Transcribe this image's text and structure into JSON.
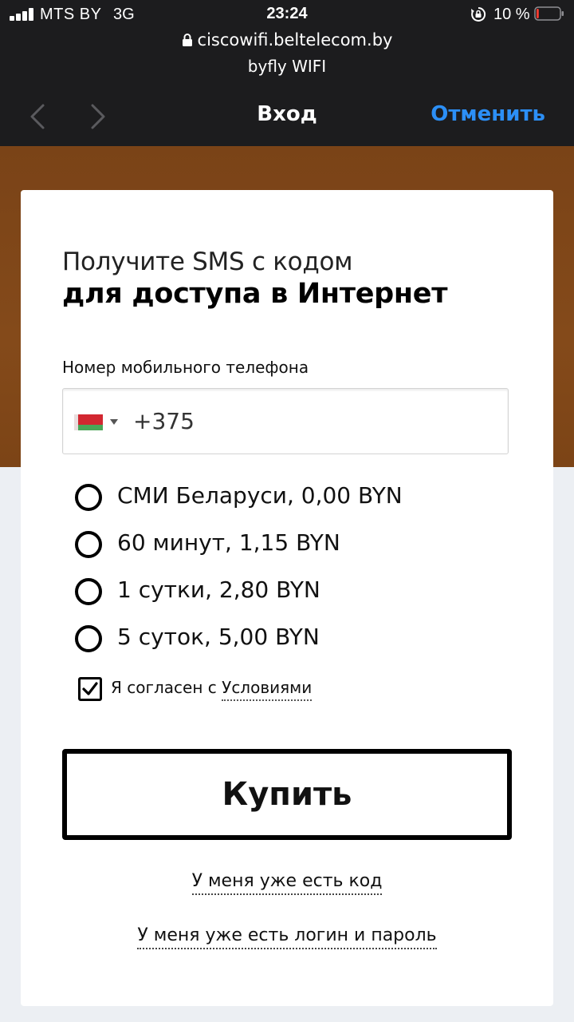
{
  "status_bar": {
    "carrier": "MTS BY",
    "network": "3G",
    "time": "23:24",
    "battery_percent": "10 %",
    "signal_bars": 4,
    "battery_level": 0.1,
    "icons": [
      "signal-icon",
      "orientation-lock-icon",
      "battery-icon"
    ]
  },
  "browser": {
    "url": "ciscowifi.beltelecom.by",
    "site_title": "byfly WIFI",
    "page_heading": "Вход",
    "cancel_label": "Отменить",
    "icons": [
      "padlock-icon",
      "back-chevron-icon",
      "forward-chevron-icon"
    ]
  },
  "card": {
    "headline_light": "Получите SMS с кодом",
    "headline_bold": "для доступа в Интернет",
    "phone_label": "Номер мобильного телефона",
    "phone_value": "+375",
    "country_flag": "belarus-flag-icon",
    "options": [
      {
        "label": "СМИ Беларуси, 0,00 BYN",
        "selected": false
      },
      {
        "label": "60 минут, 1,15 BYN",
        "selected": false
      },
      {
        "label": "1 сутки, 2,80 BYN",
        "selected": false
      },
      {
        "label": "5 суток, 5,00 BYN",
        "selected": false
      }
    ],
    "agree_prefix": "Я согласен с ",
    "agree_link": "Условиями",
    "agree_checked": true,
    "buy_label": "Купить",
    "link_have_code": "У меня уже есть код",
    "link_have_login": "У меня уже есть логин и пароль"
  },
  "colors": {
    "chrome_background": "#1c1c1e",
    "accent_link": "#2c8ff6",
    "backdrop_brown": "#844a1a",
    "battery_low": "#ff3b30",
    "page_background": "#eceff3"
  }
}
